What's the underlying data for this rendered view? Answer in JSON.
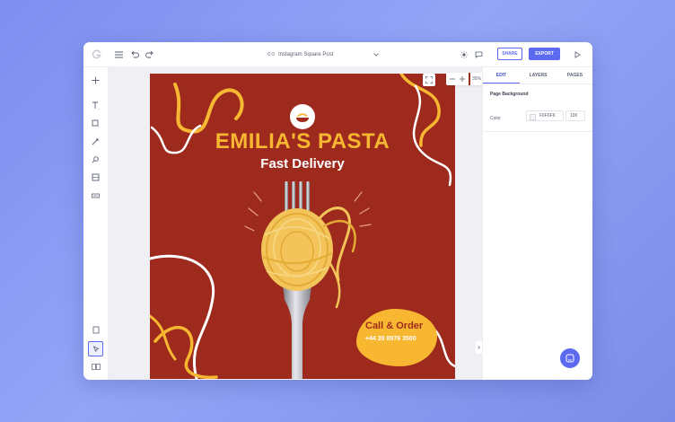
{
  "document": {
    "title": "Instagram Square Post"
  },
  "toolbar": {
    "share_label": "SHARE",
    "export_label": "EXPORT"
  },
  "zoom": {
    "level": "35%"
  },
  "panel": {
    "tabs": [
      "EDIT",
      "LAYERS",
      "PAGES"
    ],
    "active_tab": "EDIT",
    "section_title": "Page Background",
    "color_label": "Color",
    "color_hex": "F6F6F6",
    "opacity": "100"
  },
  "design": {
    "brand": "EMILIA'S PASTA",
    "tagline": "Fast Delivery",
    "cta_title": "Call & Order",
    "cta_phone": "+44 20 8976 3500"
  },
  "colors": {
    "accent": "#5b6af0",
    "canvas_bg": "#9e2a1e",
    "brand_yellow": "#f7b731",
    "page_bg": "#7d8ef0"
  }
}
